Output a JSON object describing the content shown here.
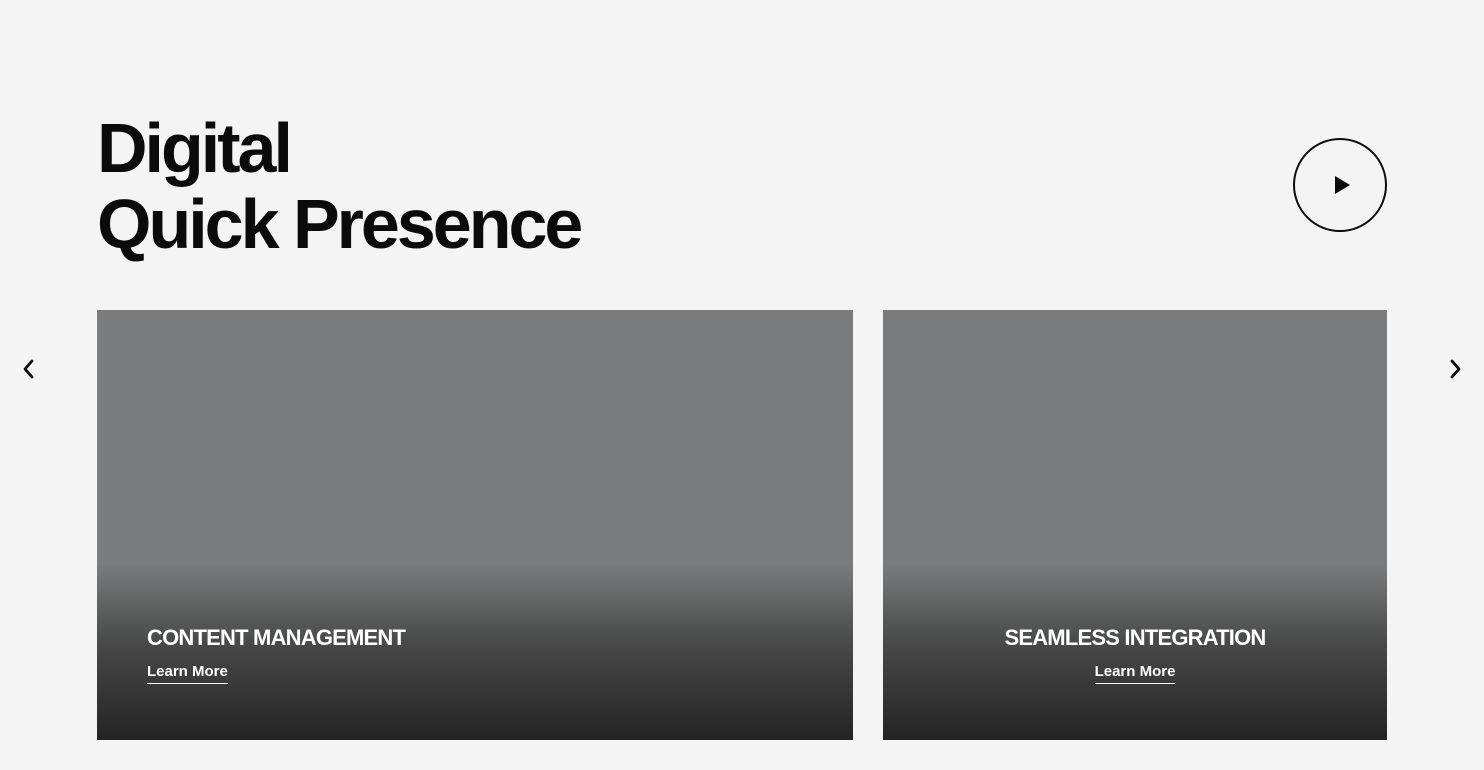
{
  "hero": {
    "title_line_1": "Digital",
    "title_line_2": "Quick Presence"
  },
  "controls": {
    "play_icon": "play-icon",
    "prev_icon": "chevron-left-icon",
    "next_icon": "chevron-right-icon"
  },
  "cards": [
    {
      "title": "CONTENT MANAGEMENT",
      "link_label": "Learn More"
    },
    {
      "title": "SEAMLESS INTEGRATION",
      "link_label": "Learn More"
    }
  ],
  "colors": {
    "background": "#f4f4f4",
    "card": "#7a7b7c",
    "text": "#0b0b0b",
    "card_text": "#ffffff"
  }
}
